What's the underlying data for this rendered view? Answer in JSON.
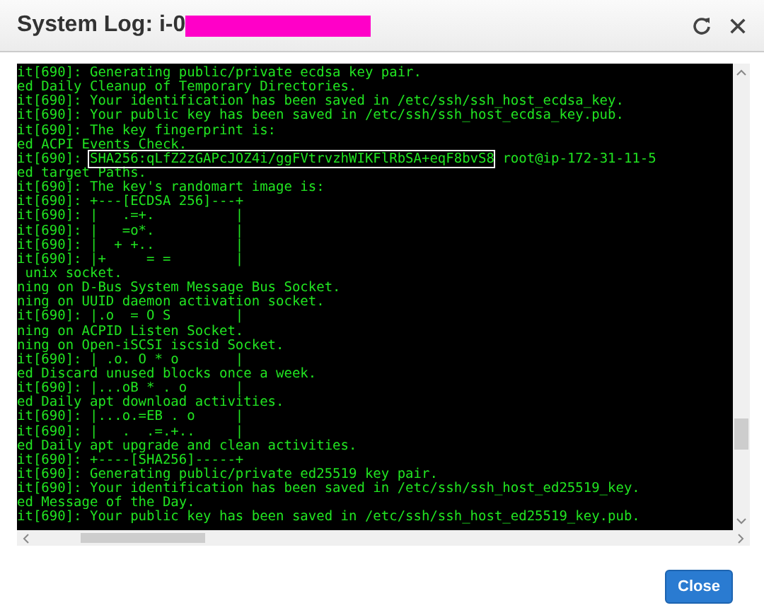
{
  "window": {
    "title": "System Log: i-0",
    "title_redacted": true
  },
  "log": {
    "lines": [
      {
        "kind": "plain",
        "text": "it[690]: Generating public/private ecdsa key pair."
      },
      {
        "kind": "plain",
        "text": "ed Daily Cleanup of Temporary Directories."
      },
      {
        "kind": "plain",
        "text": "it[690]: Your identification has been saved in /etc/ssh/ssh_host_ecdsa_key."
      },
      {
        "kind": "plain",
        "text": "it[690]: Your public key has been saved in /etc/ssh/ssh_host_ecdsa_key.pub."
      },
      {
        "kind": "plain",
        "text": "it[690]: The key fingerprint is:"
      },
      {
        "kind": "plain",
        "text": "ed ACPI Events Check."
      },
      {
        "kind": "highlighted",
        "prefix": "it[690]: ",
        "highlight": "SHA256:qLfZ2zGAPcJOZ4i/ggFVtrvzhWIKFlRbSA+eqF8bvS8",
        "suffix": " root@ip-172-31-11-5"
      },
      {
        "kind": "plain",
        "text": "ed target Paths."
      },
      {
        "kind": "plain",
        "text": "it[690]: The key's randomart image is:"
      },
      {
        "kind": "plain",
        "text": "it[690]: +---[ECDSA 256]---+"
      },
      {
        "kind": "plain",
        "text": "it[690]: |   .=+.          |"
      },
      {
        "kind": "plain",
        "text": "it[690]: |   =o*.          |"
      },
      {
        "kind": "plain",
        "text": "it[690]: |  + +..          |"
      },
      {
        "kind": "plain",
        "text": "it[690]: |+     = =        |"
      },
      {
        "kind": "plain",
        "text": " unix socket."
      },
      {
        "kind": "plain",
        "text": "ning on D-Bus System Message Bus Socket."
      },
      {
        "kind": "plain",
        "text": "ning on UUID daemon activation socket."
      },
      {
        "kind": "plain",
        "text": "it[690]: |.o  = O S        |"
      },
      {
        "kind": "plain",
        "text": "ning on ACPID Listen Socket."
      },
      {
        "kind": "plain",
        "text": "ning on Open-iSCSI iscsid Socket."
      },
      {
        "kind": "plain",
        "text": "it[690]: | .o. O * o       |"
      },
      {
        "kind": "plain",
        "text": "ed Discard unused blocks once a week."
      },
      {
        "kind": "plain",
        "text": "it[690]: |...oB * . o      |"
      },
      {
        "kind": "plain",
        "text": "ed Daily apt download activities."
      },
      {
        "kind": "plain",
        "text": "it[690]: |...o.=EB . o     |"
      },
      {
        "kind": "plain",
        "text": "it[690]: |   .  .=.+..     |"
      },
      {
        "kind": "plain",
        "text": "ed Daily apt upgrade and clean activities."
      },
      {
        "kind": "plain",
        "text": "it[690]: +----[SHA256]-----+"
      },
      {
        "kind": "plain",
        "text": "it[690]: Generating public/private ed25519 key pair."
      },
      {
        "kind": "plain",
        "text": "it[690]: Your identification has been saved in /etc/ssh/ssh_host_ed25519_key."
      },
      {
        "kind": "plain",
        "text": "ed Message of the Day."
      },
      {
        "kind": "plain",
        "text": "it[690]: Your public key has been saved in /etc/ssh/ssh_host_ed25519_key.pub."
      }
    ]
  },
  "buttons": [
    "Close"
  ]
}
